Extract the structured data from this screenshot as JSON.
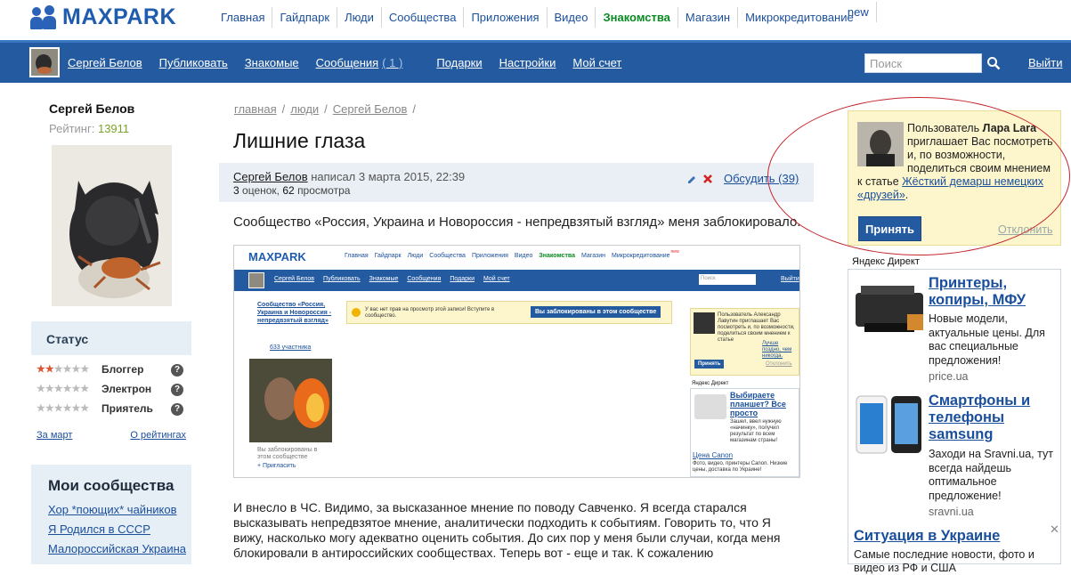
{
  "brand": {
    "logo_text": "MAXPARK"
  },
  "top_nav": {
    "items": [
      "Главная",
      "Гайдпарк",
      "Люди",
      "Сообщества",
      "Приложения",
      "Видео",
      "Знакомства",
      "Магазин",
      "Микрокредитование"
    ],
    "new_badge": "new"
  },
  "user_bar": {
    "items": [
      {
        "label": "Сергей Белов"
      },
      {
        "label": "Публиковать"
      },
      {
        "label": "Знакомые"
      },
      {
        "label": "Сообщения",
        "count": "( 1 )"
      },
      {
        "label": "Подарки"
      },
      {
        "label": "Настройки"
      },
      {
        "label": "Мой счет"
      }
    ],
    "search_placeholder": "Поиск",
    "logout": "Выйти"
  },
  "profile": {
    "name": "Сергей Белов",
    "rating_label": "Рейтинг:",
    "rating_value": "13911"
  },
  "status": {
    "title": "Статус",
    "rows": [
      {
        "label": "Блоггер",
        "stars_on": 2
      },
      {
        "label": "Электрон",
        "stars_on": 0
      },
      {
        "label": "Приятель",
        "stars_on": 0
      }
    ],
    "link_left": "За март",
    "link_right": "О рейтингах",
    "help": "?"
  },
  "communities": {
    "title": "Мои сообщества",
    "items": [
      "Хор *поющих* чайников",
      "Я Родился в СССР",
      "Малороссийская Украина"
    ]
  },
  "breadcrumb": {
    "items": [
      "главная",
      "люди",
      "Сергей Белов"
    ],
    "sep": "/"
  },
  "article": {
    "title": "Лишние глаза",
    "author": "Сергей Белов",
    "wrote": "написал 3 марта 2015, 22:39",
    "ratings_count": "3",
    "ratings_label": "оценок,",
    "views_count": "62",
    "views_label": "просмотра",
    "discuss": "Обсудить (39)",
    "para1": "Сообщество «Россия, Украина и Новороссия - непредвзятый взгляд» меня заблокировало.",
    "para2": "И внесло в ЧС. Видимо, за высказанное мнение по поводу Савченко. Я всегда старался высказывать непредвзятое мнение, аналитически подходить к событиям. Говорить то, что Я вижу, насколько могу адекватно оценить события. До сих пор у меня были случаи, когда меня блокировали в антироссийских сообществах. Теперь вот - еще и так. К сожалению"
  },
  "embedded": {
    "logo": "MAXPARK",
    "nav": [
      "Главная",
      "Гайдпарк",
      "Люди",
      "Сообщества",
      "Приложения",
      "Видео",
      "Знакомства",
      "Магазин",
      "Микрокредитование"
    ],
    "new_badge": "new",
    "bar": [
      "Сергей Белов",
      "Публиковать",
      "Знакомые",
      "Сообщения",
      "Подарки",
      "Мой счет"
    ],
    "search": "Поиск",
    "logout": "Выйти",
    "community_title": "Сообщество «Россия, Украина и Новороссия - непредвзятый взгляд»",
    "members": "633 участника",
    "warn": "У вас нет прав на просмотр этой записи! Вступите в сообщество.",
    "blocked_btn": "Вы заблокированы в этом сообществе",
    "blocked_note": "Вы заблокированы в этом сообществе",
    "invite_friend": "Пригласить",
    "invite_text": "Пользователь Александр Лавутин приглашает Вас посмотреть и, по возможности, поделиться своим мнением к статье",
    "invite_link": "Лучше поздно, чем никогда.",
    "accept": "Принять",
    "decline": "Отклонить",
    "yandex": "Яндекс Директ",
    "ad_title": "Выбираете планшет? Все просто",
    "ad_body": "Зашел, ввел нужную «начинку», получил результат по всем магазинам страны!",
    "ad2_title": "Цена Canon",
    "ad2_body": "Фото, видео, принтеры Canon. Низкие цены, доставка по Украине!"
  },
  "invite": {
    "prefix": "Пользователь",
    "user": "Лара Lara",
    "text": "приглашает Вас посмотреть и, по возможности, поделиться своим мнением к статье",
    "link": "Жёсткий демарш немецких «друзей»",
    "suffix": ".",
    "accept": "Принять",
    "decline": "Отклонить"
  },
  "ads": {
    "label": "Яндекс Директ",
    "items": [
      {
        "title": "Принтеры, копиры, МФУ",
        "body": "Новые модели, актуальные цены. Для вас специальные предложения!",
        "url": "price.ua"
      },
      {
        "title": "Смартфоны и телефоны samsung",
        "body": "Заходи на Sravni.ua, тут всегда найдешь оптимальное предложение!",
        "url": "sravni.ua"
      },
      {
        "title": "Ситуация в Украине",
        "body": "Самые последние новости, фото и видео из РФ и США"
      }
    ],
    "close": "✕"
  },
  "colors": {
    "brand_blue": "#245aa0",
    "link": "#1a4f9c",
    "green": "#0a8a22",
    "invite_bg": "#fdf6cc",
    "annotation_red": "#c4262e"
  }
}
